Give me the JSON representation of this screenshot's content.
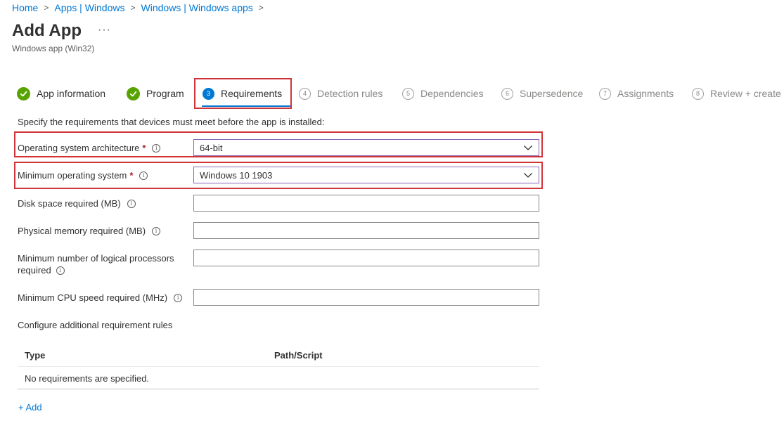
{
  "breadcrumb": {
    "items": [
      "Home",
      "Apps | Windows",
      "Windows | Windows apps"
    ],
    "separator": ">"
  },
  "header": {
    "title": "Add App",
    "more": "···",
    "subtitle": "Windows app (Win32)"
  },
  "steps": [
    {
      "label": "App information",
      "state": "done",
      "marker": ""
    },
    {
      "label": "Program",
      "state": "done",
      "marker": ""
    },
    {
      "label": "Requirements",
      "state": "active",
      "marker": "3"
    },
    {
      "label": "Detection rules",
      "state": "pending",
      "marker": "4"
    },
    {
      "label": "Dependencies",
      "state": "pending",
      "marker": "5"
    },
    {
      "label": "Supersedence",
      "state": "pending",
      "marker": "6"
    },
    {
      "label": "Assignments",
      "state": "pending",
      "marker": "7"
    },
    {
      "label": "Review + create",
      "state": "pending",
      "marker": "8"
    }
  ],
  "intro": "Specify the requirements that devices must meet before the app is installed:",
  "fields": {
    "os_arch": {
      "label": "Operating system architecture",
      "required": "*",
      "value": "64-bit"
    },
    "min_os": {
      "label": "Minimum operating system",
      "required": "*",
      "value": "Windows 10 1903"
    },
    "disk_space": {
      "label": "Disk space required (MB)",
      "value": ""
    },
    "physical_memory": {
      "label": "Physical memory required (MB)",
      "value": ""
    },
    "logical_processors": {
      "label_line1": "Minimum number of logical processors",
      "label_line2": "required",
      "value": ""
    },
    "cpu_speed": {
      "label": "Minimum CPU speed required (MHz)",
      "value": ""
    }
  },
  "info_glyph": "i",
  "rules": {
    "title": "Configure additional requirement rules",
    "columns": [
      "Type",
      "Path/Script"
    ],
    "empty_text": "No requirements are specified.",
    "add_label": "+ Add"
  },
  "colors": {
    "accent": "#0078d4",
    "success": "#57a300",
    "highlight": "#d13438",
    "required": "#a4262c"
  }
}
